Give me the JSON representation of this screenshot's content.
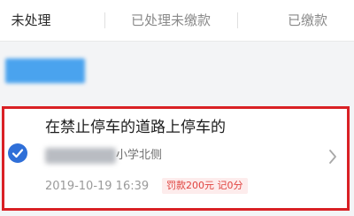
{
  "tabs": [
    {
      "label": "未处理",
      "active": true
    },
    {
      "label": "已处理未缴款",
      "active": false
    },
    {
      "label": "已缴款",
      "active": false
    }
  ],
  "record": {
    "title": "在禁止停车的道路上停车的",
    "location": "小学北侧",
    "datetime": "2019-10-19 16:39",
    "penalty": "罚款200元 记0分",
    "selected": true
  },
  "colors": {
    "accent": "#2f6fd8",
    "highlight_border": "#d92025",
    "penalty_text": "#e0433f",
    "plate_label": "#4aa3ee"
  },
  "icons": {
    "check": "check-circle-icon",
    "arrow": "chevron-right-icon"
  }
}
